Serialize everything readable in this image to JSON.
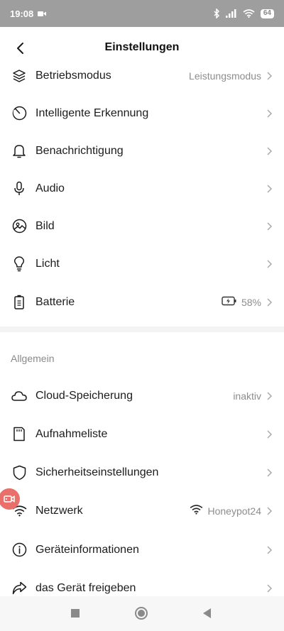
{
  "status_bar": {
    "time": "19:08",
    "battery": "64"
  },
  "header": {
    "title": "Einstellungen"
  },
  "settings": [
    {
      "label": "Betriebsmodus",
      "value": "Leistungsmodus",
      "icon": "layers-icon"
    },
    {
      "label": "Intelligente Erkennung",
      "value": "",
      "icon": "radar-icon"
    },
    {
      "label": "Benachrichtigung",
      "value": "",
      "icon": "bell-icon"
    },
    {
      "label": "Audio",
      "value": "",
      "icon": "microphone-icon"
    },
    {
      "label": "Bild",
      "value": "",
      "icon": "image-icon"
    },
    {
      "label": "Licht",
      "value": "",
      "icon": "lightbulb-icon"
    },
    {
      "label": "Batterie",
      "value": "58%",
      "icon": "battery-icon"
    }
  ],
  "general": {
    "section_title": "Allgemein",
    "items": [
      {
        "label": "Cloud-Speicherung",
        "value": "inaktiv",
        "icon": "cloud-icon"
      },
      {
        "label": "Aufnahmeliste",
        "value": "",
        "icon": "sd-card-icon"
      },
      {
        "label": "Sicherheitseinstellungen",
        "value": "",
        "icon": "shield-icon"
      },
      {
        "label": "Netzwerk",
        "value": "Honeypot24",
        "icon": "wifi-icon"
      },
      {
        "label": "Geräteinformationen",
        "value": "",
        "icon": "info-icon"
      },
      {
        "label": "das Gerät freigeben",
        "value": "",
        "icon": "share-icon"
      }
    ]
  },
  "colors": {
    "status_bar": "#9e9e9e",
    "accent_float": "#e9706a",
    "secondary_text": "#8d8d8d"
  }
}
